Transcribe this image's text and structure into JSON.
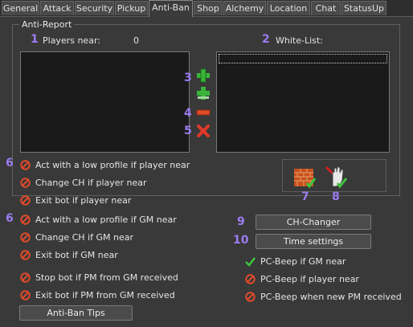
{
  "tabs": [
    "General",
    "Attack",
    "Security",
    "Pickup",
    "Anti-Ban",
    "Shop",
    "Alchemy",
    "Location",
    "Chat",
    "StatusUp"
  ],
  "active_tab": "Anti-Ban",
  "group": {
    "title": "Anti-Report",
    "players_near_label": "Players near:",
    "players_near_value": "0",
    "whitelist_label": "White-List:"
  },
  "markers": {
    "m1": "1",
    "m2": "2",
    "m3": "3",
    "m4": "4",
    "m5": "5",
    "m6a": "6",
    "m6b": "6",
    "m7": "7",
    "m8": "8",
    "m9": "9",
    "m10": "10"
  },
  "player_options": [
    "Act with a low profile if player near",
    "Change CH if player near",
    "Exit bot if player near"
  ],
  "gm_options": [
    "Act with a low profile if GM near",
    "Change CH if GM near",
    "Exit bot if GM near"
  ],
  "pm_options": [
    "Stop bot if PM from GM received",
    "Exit bot if PM from GM received"
  ],
  "buttons": {
    "ch_changer": "CH-Changer",
    "time_settings": "Time settings",
    "anti_ban_tips": "Anti-Ban Tips"
  },
  "beep_options": [
    {
      "label": "PC-Beep if GM near",
      "state": "checked"
    },
    {
      "label": "PC-Beep if player near",
      "state": "disabled"
    },
    {
      "label": "PC-Beep when new PM received",
      "state": "disabled"
    }
  ],
  "colors": {
    "accent_number": "#9b7cf0",
    "check_green": "#3cc63c",
    "stop_red": "#e04a2a",
    "add_green": "#3ab53a"
  }
}
